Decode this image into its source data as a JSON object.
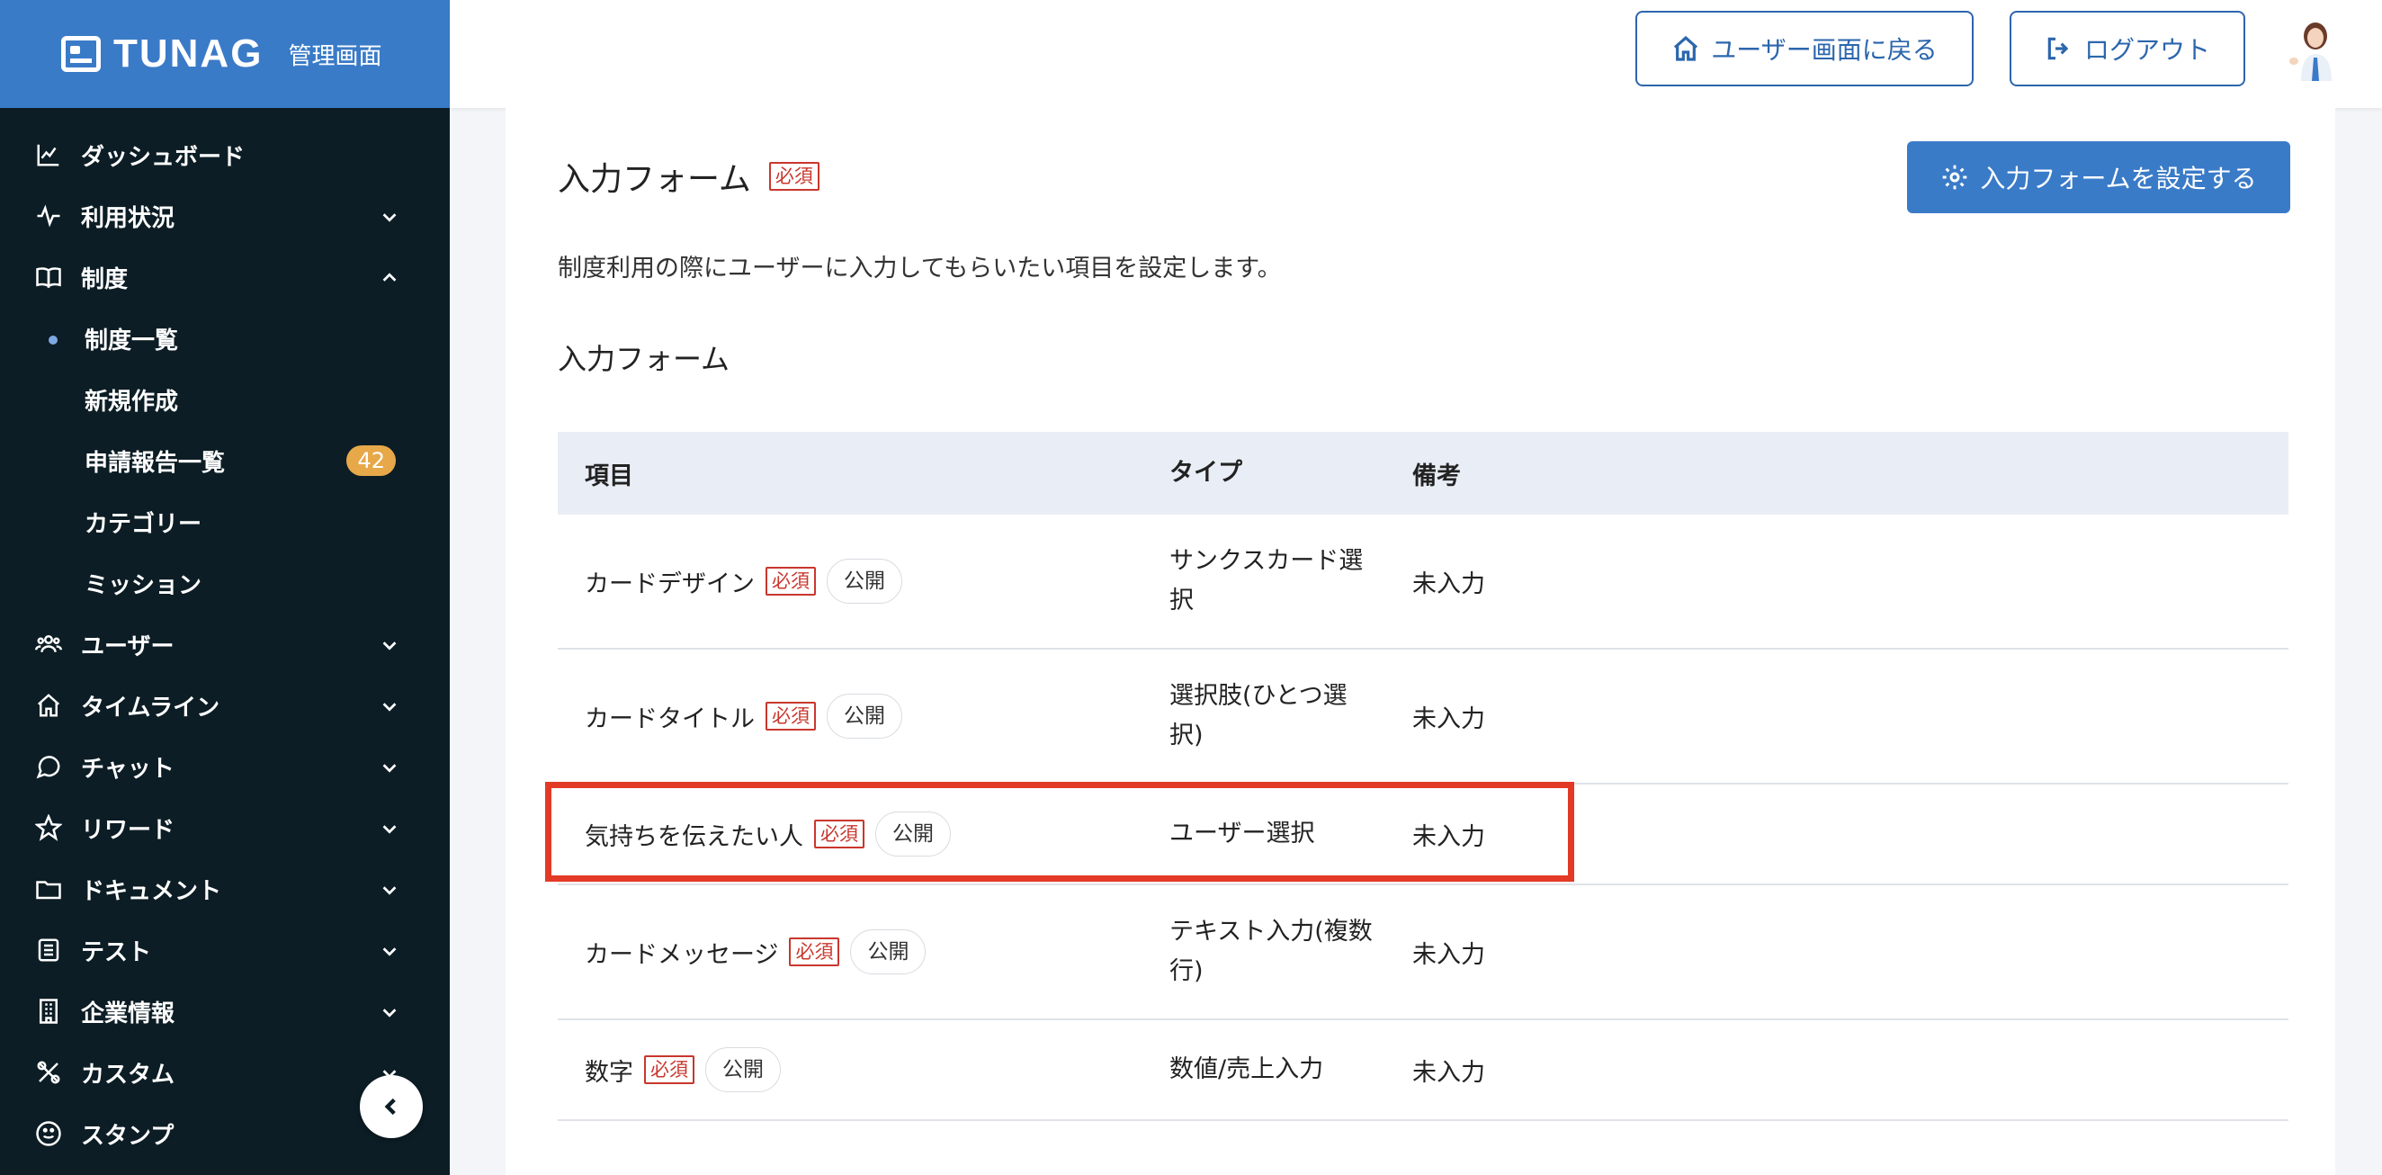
{
  "brand": {
    "name": "TUNAG",
    "subtitle": "管理画面"
  },
  "sidebar": {
    "items": [
      {
        "label": "ダッシュボード",
        "icon": "chart-line-icon",
        "chevron": ""
      },
      {
        "label": "利用状況",
        "icon": "pulse-icon",
        "chevron": "down"
      },
      {
        "label": "制度",
        "icon": "book-icon",
        "chevron": "up"
      },
      {
        "label": "ユーザー",
        "icon": "users-icon",
        "chevron": "down"
      },
      {
        "label": "タイムライン",
        "icon": "home-icon",
        "chevron": "down"
      },
      {
        "label": "チャット",
        "icon": "chat-icon",
        "chevron": "down"
      },
      {
        "label": "リワード",
        "icon": "star-icon",
        "chevron": "down"
      },
      {
        "label": "ドキュメント",
        "icon": "folder-icon",
        "chevron": "down"
      },
      {
        "label": "テスト",
        "icon": "checklist-icon",
        "chevron": "down"
      },
      {
        "label": "企業情報",
        "icon": "building-icon",
        "chevron": "down"
      },
      {
        "label": "カスタム",
        "icon": "tools-icon",
        "chevron": "down"
      },
      {
        "label": "スタンプ",
        "icon": "smile-icon",
        "chevron": ""
      }
    ],
    "sub_items": [
      {
        "label": "制度一覧",
        "active": true,
        "badge": ""
      },
      {
        "label": "新規作成",
        "active": false,
        "badge": ""
      },
      {
        "label": "申請報告一覧",
        "active": false,
        "badge": "42"
      },
      {
        "label": "カテゴリー",
        "active": false,
        "badge": ""
      },
      {
        "label": "ミッション",
        "active": false,
        "badge": ""
      }
    ]
  },
  "header": {
    "back_button": "ユーザー画面に戻る",
    "logout_button": "ログアウト"
  },
  "main": {
    "title": "入力フォーム",
    "required_label": "必須",
    "setup_button": "入力フォームを設定する",
    "description": "制度利用の際にユーザーに入力してもらいたい項目を設定します。",
    "subtitle": "入力フォーム",
    "table": {
      "headers": [
        "項目",
        "タイプ",
        "備考"
      ],
      "rows": [
        {
          "item": "カードデザイン",
          "required": "必須",
          "visibility": "公開",
          "type": "サンクスカード選択",
          "note": "未入力"
        },
        {
          "item": "カードタイトル",
          "required": "必須",
          "visibility": "公開",
          "type": "選択肢(ひとつ選択)",
          "note": "未入力"
        },
        {
          "item": "気持ちを伝えたい人",
          "required": "必須",
          "visibility": "公開",
          "type": "ユーザー選択",
          "note": "未入力"
        },
        {
          "item": "カードメッセージ",
          "required": "必須",
          "visibility": "公開",
          "type": "テキスト入力(複数行)",
          "note": "未入力"
        },
        {
          "item": "数字",
          "required": "必須",
          "visibility": "公開",
          "type": "数値/売上入力",
          "note": "未入力"
        }
      ]
    }
  },
  "colors": {
    "sidebar_bg": "#0c1d25",
    "brand_bg": "#3a7bc8",
    "primary": "#3a7bc8",
    "required": "#c8372d",
    "highlight": "#e23a26",
    "badge": "#e7a84a"
  }
}
